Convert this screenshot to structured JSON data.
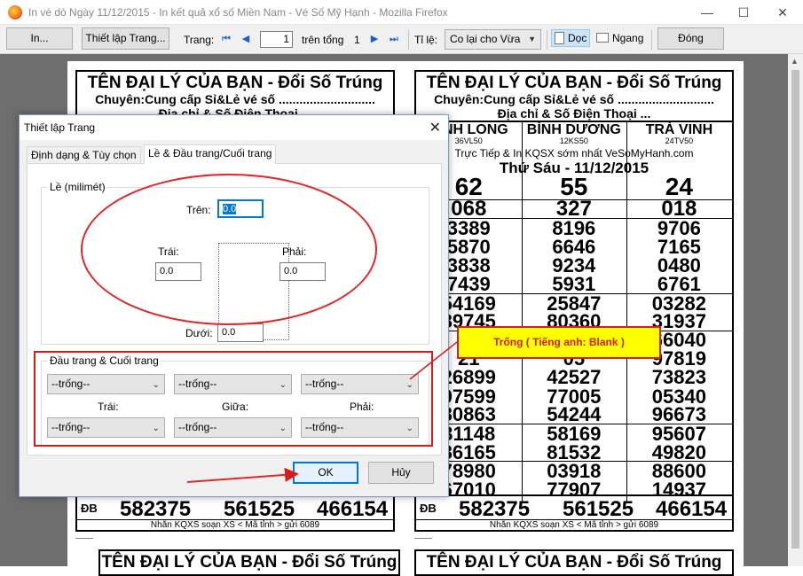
{
  "window": {
    "title": "In vé dò Ngày 11/12/2015 - In kết quả xổ số Miền Nam - Vé Số Mỹ Hạnh - Mozilla Firefox",
    "minimize": "—",
    "maximize": "☐",
    "close": "✕"
  },
  "toolbar": {
    "print_label": "In...",
    "page_setup_label": "Thiết lập Trang...",
    "page_label": "Trang:",
    "page_current": "1",
    "of_label": "trên tổng",
    "page_total": "1",
    "scale_label": "Tỉ lệ:",
    "scale_value": "Co lại cho Vừa",
    "portrait_label": "Dọc",
    "landscape_label": "Ngang",
    "close_label": "Đóng"
  },
  "tickets": [
    {
      "header": "TÊN ĐẠI LÝ CỦA BẠN - Đổi Số Trúng",
      "line2": "Chuyên:Cung cấp Sỉ&Lẻ vé số ............................",
      "line3": "Địa chỉ & Số Điện Thoại ...",
      "provinces": [],
      "sub": "",
      "date": "",
      "columns": [],
      "db_label": "ĐB",
      "db": [
        "582375",
        "561525",
        "466154"
      ],
      "footer": "Nhắn KQXS soạn XS < Mã tỉnh > gửi 6089"
    },
    {
      "header": "TÊN ĐẠI LÝ CỦA BẠN - Đổi Số Trúng",
      "line2": "Chuyên:Cung cấp Sỉ&Lẻ vé số ............................",
      "line3": "Địa chỉ & Số Điện Thoại ...",
      "provinces": [
        {
          "name": "VĨNH LONG",
          "code": "36VL50"
        },
        {
          "name": "BÌNH DƯƠNG",
          "code": "12KS50"
        },
        {
          "name": "TRÀ VINH",
          "code": "24TV50"
        }
      ],
      "sub": "Trực Tiếp & In KQSX sớm nhất VeSoMyHanh.com",
      "date": "Thứ Sáu - 11/12/2015",
      "columns": [
        [
          "62",
          "068",
          "3389",
          "5870",
          "3838",
          "7439",
          "54169",
          "89745",
          "",
          "21",
          "26899",
          "97599",
          "80863",
          "31148",
          "86165",
          "78980",
          "67010"
        ],
        [
          "55",
          "327",
          "8196",
          "6646",
          "9234",
          "5931",
          "25847",
          "80360",
          "",
          "05",
          "42527",
          "77005",
          "54244",
          "58169",
          "81532",
          "03918",
          "77907"
        ],
        [
          "24",
          "018",
          "9706",
          "7165",
          "0480",
          "6761",
          "03282",
          "31937",
          "66040",
          "97819",
          "73823",
          "05340",
          "96673",
          "95607",
          "49820",
          "88600",
          "14937"
        ]
      ],
      "db_label": "ĐB",
      "db": [
        "582375",
        "561525",
        "466154"
      ],
      "footer": "Nhắn KQXS soạn XS < Mã tỉnh > gửi 6089"
    }
  ],
  "dialog": {
    "title": "Thiết lập Trang",
    "close": "✕",
    "tabs": [
      {
        "label": "Định dạng & Tùy chọn"
      },
      {
        "label": "Lề & Đầu trang/Cuối trang"
      }
    ],
    "margins": {
      "group_label": "Lề (milimét)",
      "top_label": "Trên:",
      "top_value": "0.0",
      "left_label": "Trái:",
      "left_value": "0.0",
      "right_label": "Phải:",
      "right_value": "0.0",
      "bottom_label": "Dưới:",
      "bottom_value": "0.0"
    },
    "headers": {
      "group_label": "Đầu trang & Cuối trang",
      "header_left": "--trống--",
      "header_center": "--trống--",
      "header_right": "--trống--",
      "left_label": "Trái:",
      "center_label": "Giữa:",
      "right_label": "Phải:",
      "footer_left": "--trống--",
      "footer_center": "--trống--",
      "footer_right": "--trống--"
    },
    "ok_label": "OK",
    "cancel_label": "Hủy"
  },
  "annotation": {
    "callout": "Trống ( Tiếng anh: Blank )",
    "color": "#d81c1c"
  }
}
